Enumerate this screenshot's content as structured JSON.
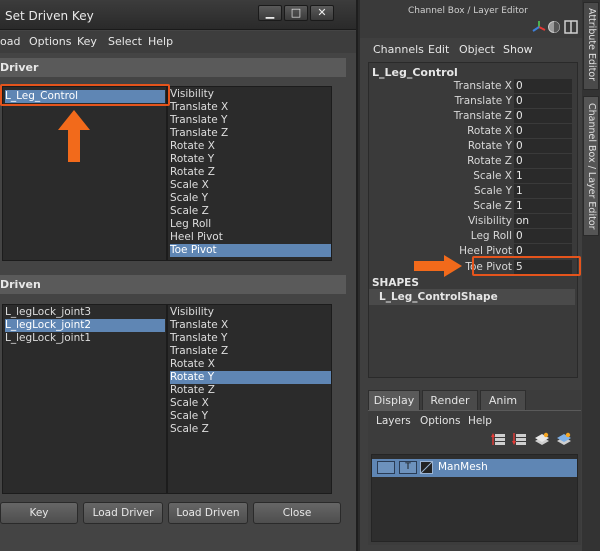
{
  "sdk": {
    "title": "Set Driven Key",
    "window_buttons": [
      "▁",
      "□",
      "✕"
    ],
    "menu": [
      "oad",
      "Options",
      "Key",
      "Select",
      "Help"
    ],
    "driver_label": "Driver",
    "driven_label": "Driven",
    "driver_objects": [
      "L_Leg_Control"
    ],
    "driver_selected_object": "L_Leg_Control",
    "driver_attributes": [
      "Visibility",
      "Translate X",
      "Translate Y",
      "Translate Z",
      "Rotate X",
      "Rotate Y",
      "Rotate Z",
      "Scale X",
      "Scale Y",
      "Scale Z",
      "Leg Roll",
      "Heel Pivot",
      "Toe Pivot"
    ],
    "driver_selected_attribute": "Toe Pivot",
    "driven_objects": [
      "L_legLock_joint3",
      "L_legLock_joint2",
      "L_legLock_joint1"
    ],
    "driven_selected_object": "L_legLock_joint2",
    "driven_attributes": [
      "Visibility",
      "Translate X",
      "Translate Y",
      "Translate Z",
      "Rotate X",
      "Rotate Y",
      "Rotate Z",
      "Scale X",
      "Scale Y",
      "Scale Z"
    ],
    "driven_selected_attribute": "Rotate Y",
    "buttons": [
      "Key",
      "Load Driver",
      "Load Driven",
      "Close"
    ]
  },
  "channel_box": {
    "heading": "Channel Box / Layer Editor",
    "menu": [
      "Channels",
      "Edit",
      "Object",
      "Show"
    ],
    "object_name": "L_Leg_Control",
    "channels": [
      {
        "label": "Translate X",
        "value": "0"
      },
      {
        "label": "Translate Y",
        "value": "0"
      },
      {
        "label": "Translate Z",
        "value": "0"
      },
      {
        "label": "Rotate X",
        "value": "0"
      },
      {
        "label": "Rotate Y",
        "value": "0"
      },
      {
        "label": "Rotate Z",
        "value": "0"
      },
      {
        "label": "Scale X",
        "value": "1"
      },
      {
        "label": "Scale Y",
        "value": "1"
      },
      {
        "label": "Scale Z",
        "value": "1"
      },
      {
        "label": "Visibility",
        "value": "on"
      },
      {
        "label": "Leg Roll",
        "value": "0"
      },
      {
        "label": "Heel Pivot",
        "value": "0"
      },
      {
        "label": "Toe Pivot",
        "value": "5"
      }
    ],
    "shapes_heading": "SHAPES",
    "shape_name": "L_Leg_ControlShape",
    "side_tabs": [
      "Attribute Editor",
      "Channel Box / Layer Editor"
    ]
  },
  "layer_editor": {
    "tabs": [
      "Display",
      "Render",
      "Anim"
    ],
    "active_tab": "Display",
    "menu": [
      "Layers",
      "Options",
      "Help"
    ],
    "layer": {
      "visibility": "",
      "type": "T",
      "name": "ManMesh"
    }
  },
  "colors": {
    "selection": "#5f86b4",
    "highlight": "#e5541c"
  }
}
